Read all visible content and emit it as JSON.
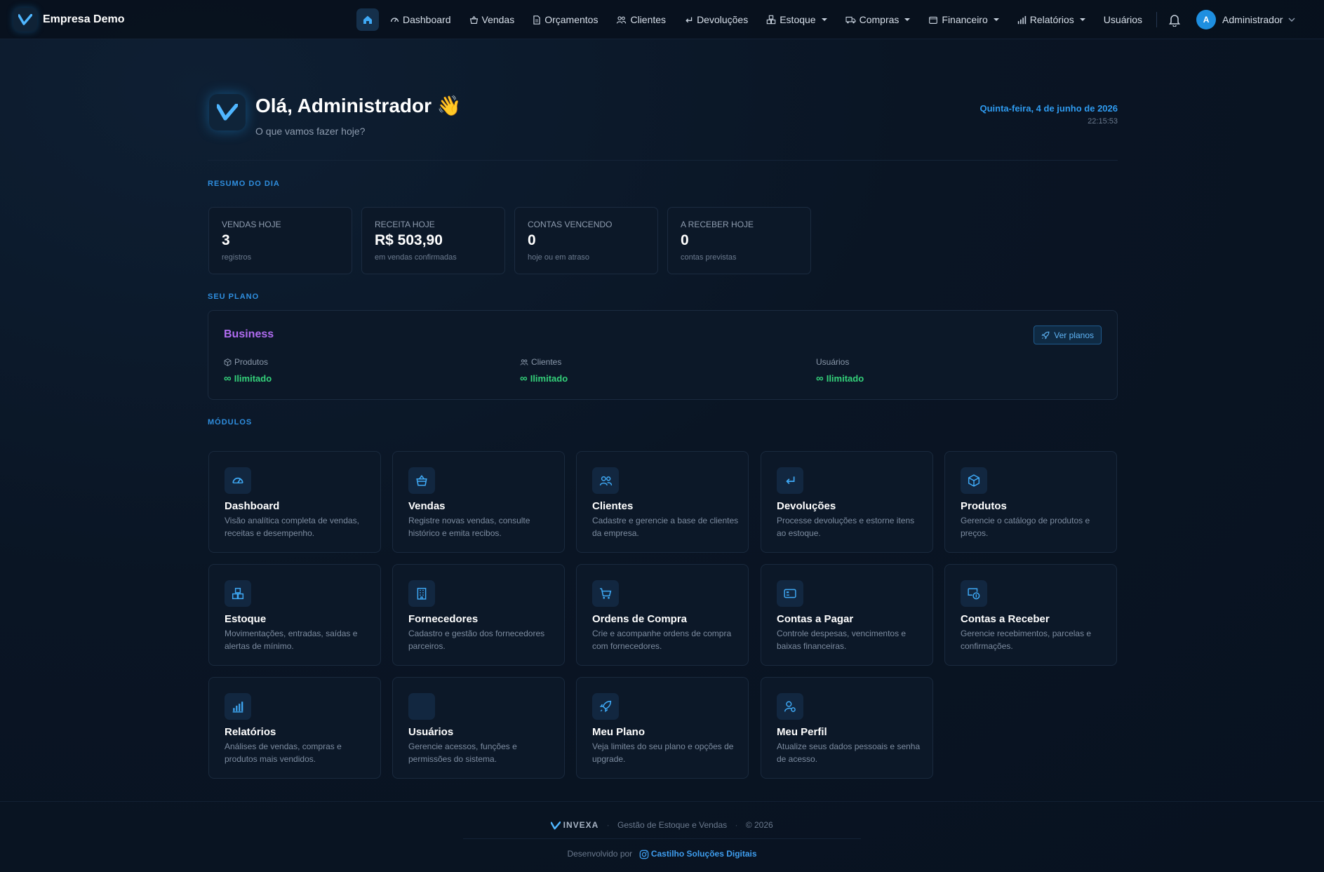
{
  "brand": {
    "name": "Empresa Demo",
    "logo_icon": "v-logo-icon"
  },
  "nav": {
    "items": [
      {
        "label": "Dashboard",
        "icon": "gauge-icon"
      },
      {
        "label": "Vendas",
        "icon": "basket-icon"
      },
      {
        "label": "Orçamentos",
        "icon": "document-icon"
      },
      {
        "label": "Clientes",
        "icon": "people-icon"
      },
      {
        "label": "Devoluções",
        "icon": "return-icon"
      },
      {
        "label": "Estoque",
        "icon": "boxes-icon",
        "dropdown": true
      },
      {
        "label": "Compras",
        "icon": "truck-icon",
        "dropdown": true
      },
      {
        "label": "Financeiro",
        "icon": "wallet-icon",
        "dropdown": true
      },
      {
        "label": "Relatórios",
        "icon": "bar-chart-icon",
        "dropdown": true
      },
      {
        "label": "Usuários"
      }
    ],
    "user_initial": "A",
    "user_name": "Administrador"
  },
  "header": {
    "greeting": "Olá, Administrador 👋",
    "subtitle": "O que vamos fazer hoje?",
    "date": "Quinta-feira, 4 de junho de 2026",
    "time": "22:15:53"
  },
  "summary": {
    "title": "RESUMO DO DIA",
    "cards": [
      {
        "label": "VENDAS HOJE",
        "value": "3",
        "note": "registros"
      },
      {
        "label": "RECEITA HOJE",
        "value": "R$ 503,90",
        "note": "em vendas confirmadas"
      },
      {
        "label": "CONTAS VENCENDO",
        "value": "0",
        "note": "hoje ou em atraso"
      },
      {
        "label": "A RECEBER HOJE",
        "value": "0",
        "note": "contas previstas"
      }
    ]
  },
  "plan": {
    "section_title": "SEU PLANO",
    "name": "Business",
    "button": "Ver planos",
    "limits": [
      {
        "label": "Produtos",
        "value": "Ilimitado"
      },
      {
        "label": "Clientes",
        "value": "Ilimitado"
      },
      {
        "label": "Usuários",
        "value": "Ilimitado"
      }
    ]
  },
  "modules": {
    "section_title": "MÓDULOS",
    "items": [
      {
        "title": "Dashboard",
        "desc": "Visão analítica completa de vendas, receitas e desempenho.",
        "icon": "gauge-icon"
      },
      {
        "title": "Vendas",
        "desc": "Registre novas vendas, consulte histórico e emita recibos.",
        "icon": "basket-icon"
      },
      {
        "title": "Clientes",
        "desc": "Cadastre e gerencie a base de clientes da empresa.",
        "icon": "people-icon"
      },
      {
        "title": "Devoluções",
        "desc": "Processe devoluções e estorne itens ao estoque.",
        "icon": "return-icon"
      },
      {
        "title": "Produtos",
        "desc": "Gerencie o catálogo de produtos e preços.",
        "icon": "box-icon"
      },
      {
        "title": "Estoque",
        "desc": "Movimentações, entradas, saídas e alertas de mínimo.",
        "icon": "boxes-icon"
      },
      {
        "title": "Fornecedores",
        "desc": "Cadastro e gestão dos fornecedores parceiros.",
        "icon": "building-icon"
      },
      {
        "title": "Ordens de Compra",
        "desc": "Crie e acompanhe ordens de compra com fornecedores.",
        "icon": "cart-icon"
      },
      {
        "title": "Contas a Pagar",
        "desc": "Controle despesas, vencimentos e baixas financeiras.",
        "icon": "card-icon"
      },
      {
        "title": "Contas a Receber",
        "desc": "Gerencie recebimentos, parcelas e confirmações.",
        "icon": "cash-coin-icon"
      },
      {
        "title": "Relatórios",
        "desc": "Análises de vendas, compras e produtos mais vendidos.",
        "icon": "bar-chart-icon"
      },
      {
        "title": "Usuários",
        "desc": "Gerencie acessos, funções e permissões do sistema.",
        "icon": ""
      },
      {
        "title": "Meu Plano",
        "desc": "Veja limites do seu plano e opções de upgrade.",
        "icon": "rocket-icon"
      },
      {
        "title": "Meu Perfil",
        "desc": "Atualize seus dados pessoais e senha de acesso.",
        "icon": "user-gear-icon"
      }
    ]
  },
  "footer": {
    "brand": "INVEXA",
    "tagline": "Gestão de Estoque e Vendas",
    "copyright": "© 2026",
    "dev_prefix": "Desenvolvido por",
    "dev_name": "Castilho Soluções Digitais"
  },
  "colors": {
    "background": "#0a1524",
    "accent": "#2f9bf0",
    "plan_name": "#b06cf0",
    "unlimited": "#34d17a"
  }
}
